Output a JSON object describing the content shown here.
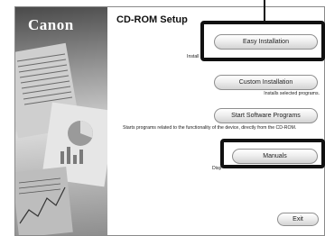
{
  "window": {
    "brand": "Canon",
    "title": "CD-ROM Setup"
  },
  "buttons": {
    "easy": "Easy Installation",
    "custom": "Custom Installation",
    "start": "Start Software Programs",
    "manuals": "Manuals",
    "exit": "Exit"
  },
  "descriptions": {
    "easy": "Install",
    "custom": "Installs selected programs.",
    "start": "Starts programs related to the functionality of the device, directly from the CD-ROM.",
    "manuals": "Disp"
  }
}
